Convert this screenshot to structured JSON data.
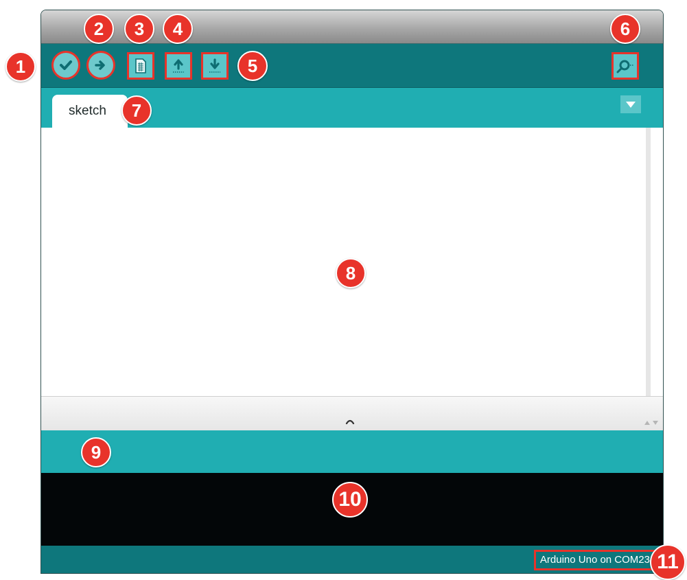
{
  "toolbar": {
    "buttons": [
      {
        "name": "verify",
        "icon": "checkmark-icon"
      },
      {
        "name": "upload",
        "icon": "arrow-right-icon"
      },
      {
        "name": "new",
        "icon": "new-document-icon"
      },
      {
        "name": "open",
        "icon": "arrow-up-icon"
      },
      {
        "name": "save",
        "icon": "arrow-down-icon"
      },
      {
        "name": "serial-monitor",
        "icon": "magnifier-icon"
      }
    ]
  },
  "tabs": [
    {
      "label": "sketch"
    }
  ],
  "status": {
    "board": "Arduino Uno on COM23"
  },
  "callouts": [
    "1",
    "2",
    "3",
    "4",
    "5",
    "6",
    "7",
    "8",
    "9",
    "10",
    "11"
  ],
  "colors": {
    "toolbar": "#0e777c",
    "tab_bar": "#20aeb2",
    "console": "#030608",
    "callout": "#e8332a",
    "button_fill": "#5bc6c9"
  }
}
